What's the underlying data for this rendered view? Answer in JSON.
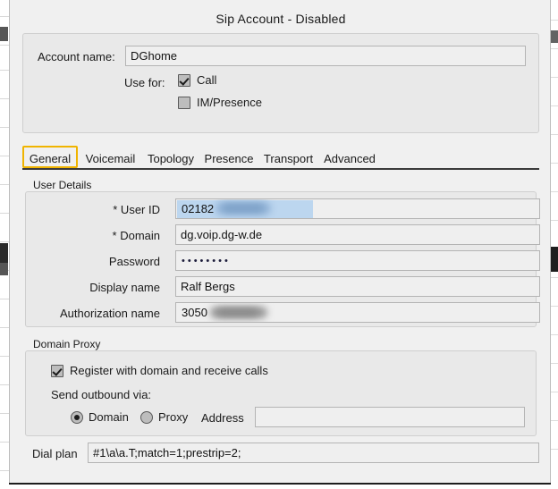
{
  "window": {
    "title": "Sip Account - Disabled"
  },
  "account": {
    "name_label": "Account name:",
    "name_value": "DGhome",
    "use_for_label": "Use for:",
    "options": [
      {
        "label": "Call",
        "checked": true
      },
      {
        "label": "IM/Presence",
        "checked": false
      }
    ]
  },
  "tabs": {
    "selected": "General",
    "items": [
      {
        "label": "General"
      },
      {
        "label": "Voicemail"
      },
      {
        "label": "Topology"
      },
      {
        "label": "Presence"
      },
      {
        "label": "Transport"
      },
      {
        "label": "Advanced"
      }
    ]
  },
  "user_details": {
    "group_label": "User Details",
    "fields": [
      {
        "label": "* User ID",
        "value": "02182",
        "redacted": true
      },
      {
        "label": "* Domain",
        "value": "dg.voip.dg-w.de",
        "redacted": false
      },
      {
        "label": "Password",
        "value": "••••••••",
        "redacted": false
      },
      {
        "label": "Display name",
        "value": "Ralf Bergs",
        "redacted": false
      },
      {
        "label": "Authorization name",
        "value": "3050",
        "redacted": true
      }
    ]
  },
  "domain_proxy": {
    "group_label": "Domain Proxy",
    "register_label": "Register with domain and receive calls",
    "register_checked": true,
    "send_outbound_label": "Send outbound via:",
    "route_options": [
      {
        "label": "Domain",
        "selected": true
      },
      {
        "label": "Proxy",
        "selected": false
      }
    ],
    "address_label": "Address",
    "address_value": "",
    "address_placeholder": ""
  },
  "dial_plan": {
    "label": "Dial plan",
    "value": "#1\\a\\a.T;match=1;prestrip=2;"
  },
  "colors": {
    "focus_ring": "#f0b400",
    "panel": "#f0f0f0",
    "group": "#e9e9e9",
    "input": "#efefef",
    "border": "#b4b4b4"
  }
}
